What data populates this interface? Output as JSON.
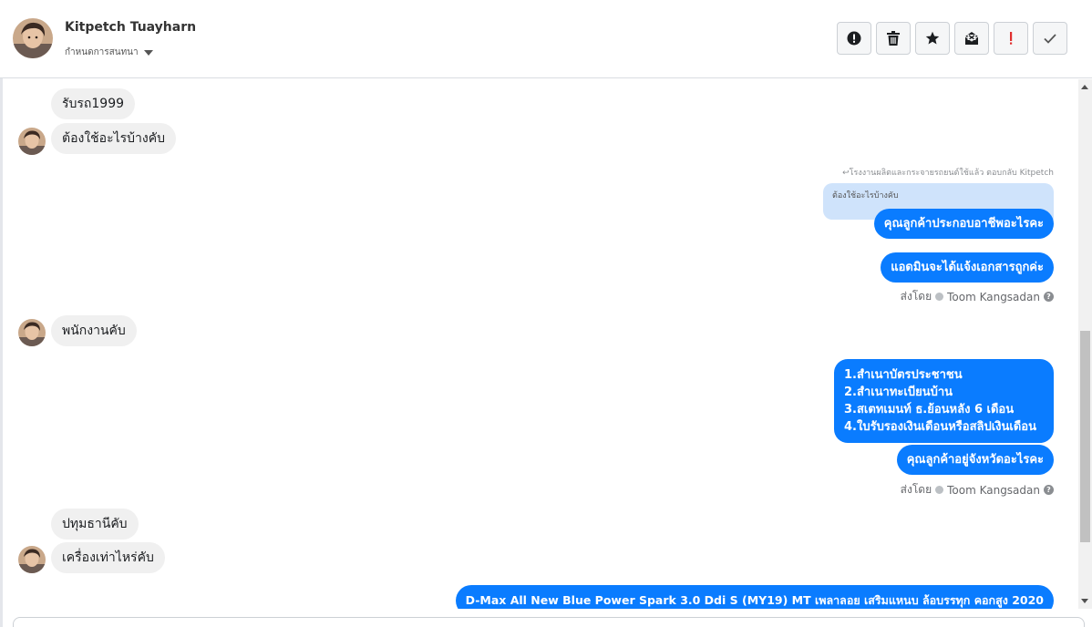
{
  "header": {
    "name": "Kitpetch Tuayharn",
    "action_label": "กำหนดการสนทนา",
    "toolbar": [
      {
        "icon": "alert-circle-icon"
      },
      {
        "icon": "trash-icon"
      },
      {
        "icon": "star-icon"
      },
      {
        "icon": "mail-x-icon"
      },
      {
        "icon": "exclamation-icon"
      },
      {
        "icon": "check-icon"
      }
    ]
  },
  "messages": {
    "in1": "รับรถ1999",
    "in2": "ต้องใช้อะไรบ้างคับ",
    "reply_meta": "โรงงานผลิตและกระจายรถยนต์ใช้แล้ว ตอบกลับ Kitpetch",
    "reply_quote": "ต้องใช้อะไรบ้างคับ",
    "out1": "คุณลูกค้าประกอบอาชีพอะไรคะ",
    "out2": "แอดมินจะได้แจ้งเอกสารถูกค่ะ",
    "sentby1_prefix": "ส่งโดย",
    "sentby1_name": "Toom Kangsadan",
    "in3": "พนักงานคับ",
    "out3_lines": [
      "1.สำเนาบัตรประชาชน",
      "2.สำเนาทะเบียนบ้าน",
      "3.สเตทเมนท์ ธ.ย้อนหลัง 6 เดือน",
      "4.ใบรับรองเงินเดือนหรือสลิปเงินเดือน"
    ],
    "out4": "คุณลูกค้าอยู่จังหวัดอะไรคะ",
    "sentby2_prefix": "ส่งโดย",
    "sentby2_name": "Toom Kangsadan",
    "in4": "ปทุมธานีคับ",
    "in5": "เครื่องเท่าไหร่คับ",
    "out5": "D-Max All New Blue Power Spark 3.0 Ddi S (MY19) MT เพลาลอย เสริมแหนบ ล้อบรรทุก คอกสูง 2020"
  },
  "colors": {
    "outgoing": "#0a7cff",
    "incoming": "#f0f0f0",
    "quote": "#cfe3fb"
  }
}
